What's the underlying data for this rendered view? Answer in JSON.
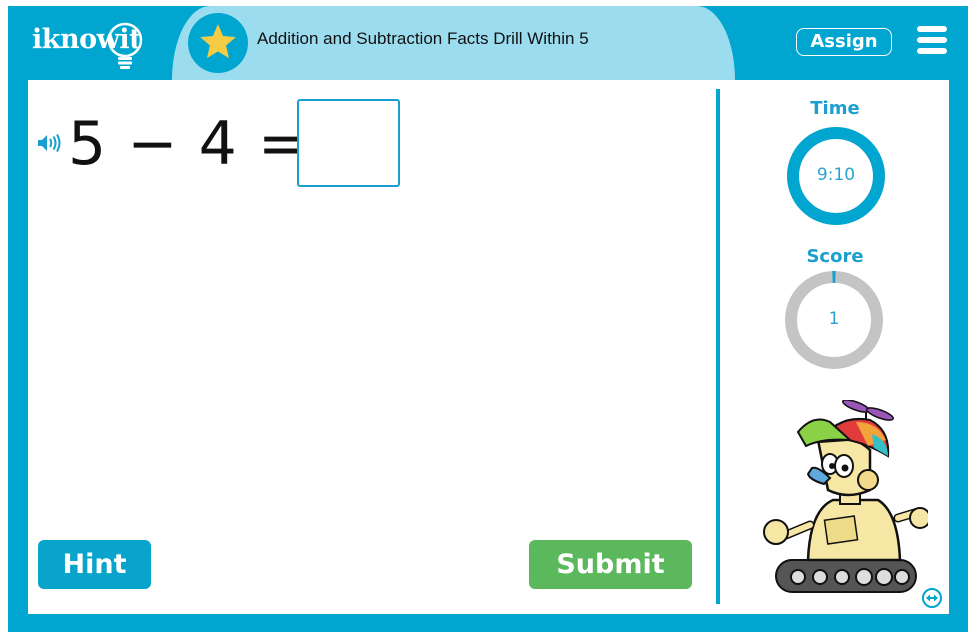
{
  "header": {
    "logo": "iknowit",
    "title": "Addition and Subtraction Facts Drill Within 5",
    "title_icon": "star-icon",
    "assign_label": "Assign",
    "menu_icon": "hamburger-menu-icon"
  },
  "question": {
    "audio_icon": "speaker-icon",
    "expression": "5 − 4 =",
    "answer_value": "",
    "answer_placeholder": ""
  },
  "buttons": {
    "hint_label": "Hint",
    "submit_label": "Submit"
  },
  "sidebar": {
    "time_label": "Time",
    "time_value": "9:10",
    "time_progress": 1.0,
    "score_label": "Score",
    "score_value": "1",
    "score_progress": 0.01,
    "swap_icon": "swap-layout-icon",
    "mascot": "robot-mascot"
  },
  "colors": {
    "brand_blue": "#00a6cf",
    "tab_light_blue": "#9cdcef",
    "star_yellow": "#f5cc45",
    "submit_green": "#5cb85c",
    "ring_gray": "#c4c4c4"
  }
}
